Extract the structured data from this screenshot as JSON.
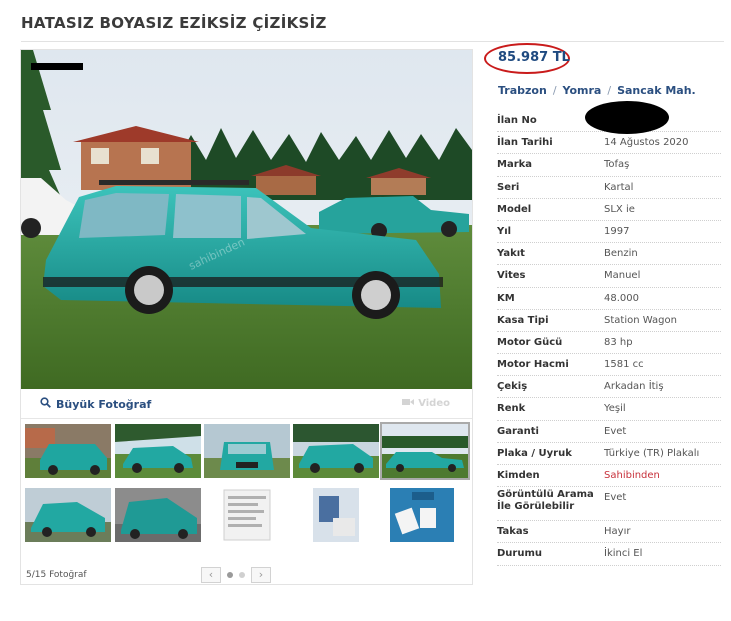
{
  "title": "HATASIZ BOYASIZ EZİKSİZ ÇİZİKSİZ",
  "gallery": {
    "big_photo_label": "Büyük Fotoğraf",
    "video_label": "Video",
    "counter": "5/15 Fotoğraf",
    "prev": "‹",
    "next": "›",
    "active_dot": 1,
    "dots": 2,
    "thumbnails": [
      {
        "desc": "thumb-1"
      },
      {
        "desc": "thumb-2"
      },
      {
        "desc": "thumb-3"
      },
      {
        "desc": "thumb-4"
      },
      {
        "desc": "thumb-5"
      },
      {
        "desc": "thumb-6"
      },
      {
        "desc": "thumb-7"
      },
      {
        "desc": "thumb-8"
      },
      {
        "desc": "thumb-9"
      },
      {
        "desc": "thumb-10"
      }
    ],
    "active_thumb": 5
  },
  "price": "85.987 TL",
  "location": {
    "city": "Trabzon",
    "district": "Yomra",
    "neighborhood": "Sancak Mah."
  },
  "details": [
    {
      "key": "İlan No",
      "value": ""
    },
    {
      "key": "İlan Tarihi",
      "value": "14 Ağustos 2020"
    },
    {
      "key": "Marka",
      "value": "Tofaş"
    },
    {
      "key": "Seri",
      "value": "Kartal"
    },
    {
      "key": "Model",
      "value": "SLX ie"
    },
    {
      "key": "Yıl",
      "value": "1997"
    },
    {
      "key": "Yakıt",
      "value": "Benzin"
    },
    {
      "key": "Vites",
      "value": "Manuel"
    },
    {
      "key": "KM",
      "value": "48.000"
    },
    {
      "key": "Kasa Tipi",
      "value": "Station Wagon"
    },
    {
      "key": "Motor Gücü",
      "value": "83 hp"
    },
    {
      "key": "Motor Hacmi",
      "value": "1581 cc"
    },
    {
      "key": "Çekiş",
      "value": "Arkadan İtiş"
    },
    {
      "key": "Renk",
      "value": "Yeşil"
    },
    {
      "key": "Garanti",
      "value": "Evet"
    },
    {
      "key": "Plaka / Uyruk",
      "value": "Türkiye (TR) Plakalı"
    },
    {
      "key": "Kimden",
      "value": "Sahibinden"
    },
    {
      "key": "Görüntülü Arama İle Görülebilir",
      "value": "Evet"
    },
    {
      "key": "Takas",
      "value": "Hayır"
    },
    {
      "key": "Durumu",
      "value": "İkinci El"
    }
  ],
  "colors": {
    "accent": "#2b4f80",
    "highlight_ring": "#c91b1b",
    "seller": "#c8323c",
    "car": "#1fa6a0"
  }
}
